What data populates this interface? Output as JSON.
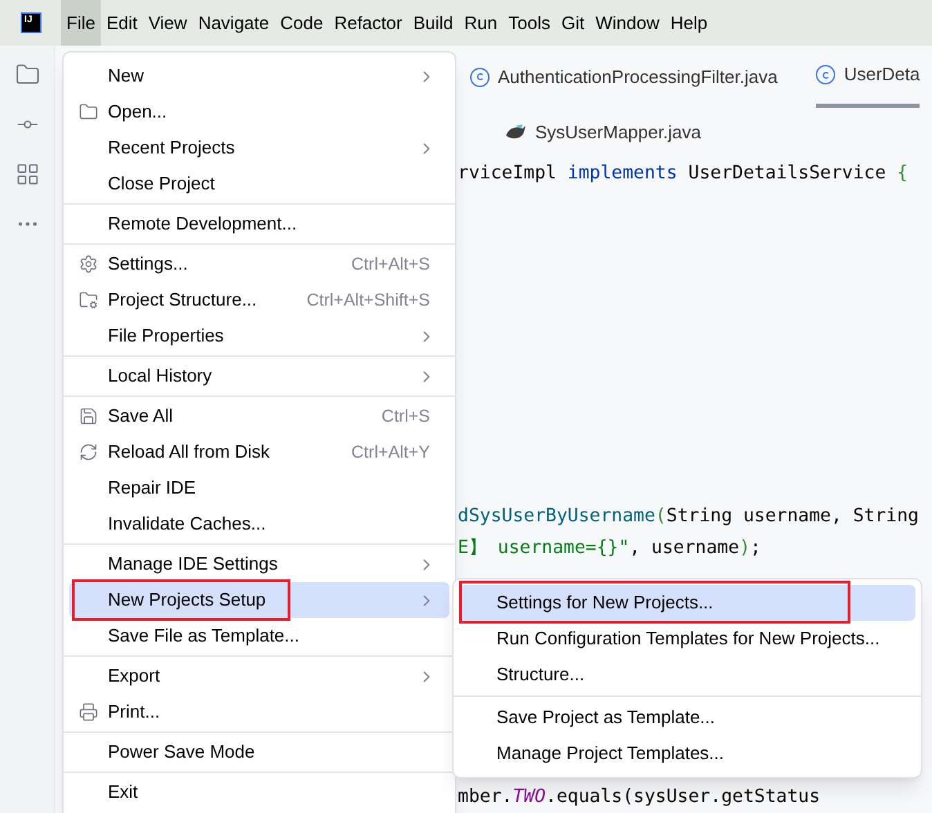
{
  "menubar": [
    {
      "label": "File",
      "selected": true
    },
    {
      "label": "Edit",
      "selected": false
    },
    {
      "label": "View",
      "selected": false
    },
    {
      "label": "Navigate",
      "selected": false
    },
    {
      "label": "Code",
      "selected": false
    },
    {
      "label": "Refactor",
      "selected": false
    },
    {
      "label": "Build",
      "selected": false
    },
    {
      "label": "Run",
      "selected": false
    },
    {
      "label": "Tools",
      "selected": false
    },
    {
      "label": "Git",
      "selected": false
    },
    {
      "label": "Window",
      "selected": false
    },
    {
      "label": "Help",
      "selected": false
    }
  ],
  "logo": {
    "text": "IJ"
  },
  "editor_tabs": [
    {
      "label": "AuthenticationProcessingFilter.java",
      "kind": "class",
      "selected": false
    },
    {
      "label": "UserDeta",
      "kind": "class",
      "selected": true
    },
    {
      "label": "SysUserMapper.java",
      "kind": "mapper",
      "selected": false
    }
  ],
  "code_lines": [
    {
      "tokens": [
        {
          "text": "rviceImpl ",
          "kind": "plain"
        },
        {
          "text": "implements",
          "kind": "keyword"
        },
        {
          "text": " UserDetailsService ",
          "kind": "plain"
        },
        {
          "text": "{",
          "kind": "brace"
        }
      ]
    },
    {
      "tokens": [
        {
          "text": "dSysUserByUsername",
          "kind": "method"
        },
        {
          "text": "(",
          "kind": "brace"
        },
        {
          "text": "String username, String",
          "kind": "plain"
        }
      ]
    },
    {
      "tokens": [
        {
          "text": "E】 username={}\"",
          "kind": "string"
        },
        {
          "text": ", username",
          "kind": "plain"
        },
        {
          "text": ")",
          "kind": "brace"
        },
        {
          "text": ";",
          "kind": "plain"
        }
      ]
    },
    {
      "tokens": [
        {
          "text": "mber.",
          "kind": "plain"
        },
        {
          "text": "TWO",
          "kind": "constant"
        },
        {
          "text": ".equals(sysUser.getStatus",
          "kind": "plain"
        }
      ]
    }
  ],
  "file_menu": [
    {
      "kind": "item",
      "label": "New",
      "submenu": true,
      "selected": false
    },
    {
      "kind": "item",
      "label": "Open...",
      "selected": false
    },
    {
      "kind": "item",
      "label": "Recent Projects",
      "submenu": true,
      "selected": false
    },
    {
      "kind": "item",
      "label": "Close Project",
      "selected": false
    },
    {
      "kind": "separator"
    },
    {
      "kind": "item",
      "label": "Remote Development...",
      "selected": false
    },
    {
      "kind": "separator"
    },
    {
      "kind": "item",
      "label": "Settings...",
      "shortcut": "Ctrl+Alt+S",
      "selected": false
    },
    {
      "kind": "item",
      "label": "Project Structure...",
      "shortcut": "Ctrl+Alt+Shift+S",
      "selected": false
    },
    {
      "kind": "item",
      "label": "File Properties",
      "submenu": true,
      "selected": false
    },
    {
      "kind": "separator"
    },
    {
      "kind": "item",
      "label": "Local History",
      "submenu": true,
      "selected": false
    },
    {
      "kind": "separator"
    },
    {
      "kind": "item",
      "label": "Save All",
      "shortcut": "Ctrl+S",
      "selected": false
    },
    {
      "kind": "item",
      "label": "Reload All from Disk",
      "shortcut": "Ctrl+Alt+Y",
      "selected": false
    },
    {
      "kind": "item",
      "label": "Repair IDE",
      "selected": false
    },
    {
      "kind": "item",
      "label": "Invalidate Caches...",
      "selected": false
    },
    {
      "kind": "separator"
    },
    {
      "kind": "item",
      "label": "Manage IDE Settings",
      "submenu": true,
      "selected": false
    },
    {
      "kind": "item",
      "label": "New Projects Setup",
      "submenu": true,
      "selected": true,
      "annotated": true
    },
    {
      "kind": "item",
      "label": "Save File as Template...",
      "selected": false
    },
    {
      "kind": "separator"
    },
    {
      "kind": "item",
      "label": "Export",
      "submenu": true,
      "selected": false
    },
    {
      "kind": "item",
      "label": "Print...",
      "selected": false
    },
    {
      "kind": "separator"
    },
    {
      "kind": "item",
      "label": "Power Save Mode",
      "selected": false
    },
    {
      "kind": "separator"
    },
    {
      "kind": "item",
      "label": "Exit",
      "selected": false
    }
  ],
  "submenu": [
    {
      "kind": "item",
      "label": "Settings for New Projects...",
      "selected": true,
      "annotated": true
    },
    {
      "kind": "item",
      "label": "Run Configuration Templates for New Projects...",
      "selected": false
    },
    {
      "kind": "item",
      "label": "Structure...",
      "selected": false
    },
    {
      "kind": "separator"
    },
    {
      "kind": "item",
      "label": "Save Project as Template...",
      "selected": false
    },
    {
      "kind": "item",
      "label": "Manage Project Templates...",
      "selected": false
    }
  ]
}
